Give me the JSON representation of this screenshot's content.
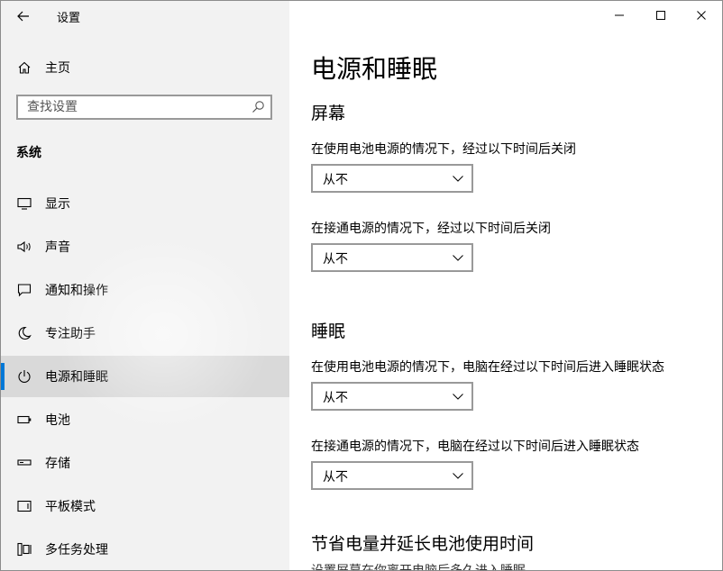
{
  "window": {
    "title": "设置"
  },
  "sidebar": {
    "home_label": "主页",
    "search_placeholder": "查找设置",
    "section_title": "系统",
    "items": [
      {
        "label": "显示",
        "icon": "monitor-icon"
      },
      {
        "label": "声音",
        "icon": "speaker-icon"
      },
      {
        "label": "通知和操作",
        "icon": "notification-icon"
      },
      {
        "label": "专注助手",
        "icon": "moon-icon"
      },
      {
        "label": "电源和睡眠",
        "icon": "power-icon",
        "active": true
      },
      {
        "label": "电池",
        "icon": "battery-icon"
      },
      {
        "label": "存储",
        "icon": "storage-icon"
      },
      {
        "label": "平板模式",
        "icon": "tablet-icon"
      },
      {
        "label": "多任务处理",
        "icon": "multitask-icon"
      }
    ]
  },
  "content": {
    "page_title": "电源和睡眠",
    "screen": {
      "title": "屏幕",
      "battery_label": "在使用电池电源的情况下，经过以下时间后关闭",
      "battery_value": "从不",
      "plugged_label": "在接通电源的情况下，经过以下时间后关闭",
      "plugged_value": "从不"
    },
    "sleep": {
      "title": "睡眠",
      "battery_label": "在使用电池电源的情况下，电脑在经过以下时间后进入睡眠状态",
      "battery_value": "从不",
      "plugged_label": "在接通电源的情况下，电脑在经过以下时间后进入睡眠状态",
      "plugged_value": "从不"
    },
    "save": {
      "title": "节省电量并延长电池使用时间",
      "desc": "设置屏幕在你离开电脑后多久进入睡眠"
    }
  },
  "colors": {
    "accent": "#0078d7",
    "sidebar_bg": "#f2f2f2",
    "active_bg": "#d9d9d9"
  }
}
